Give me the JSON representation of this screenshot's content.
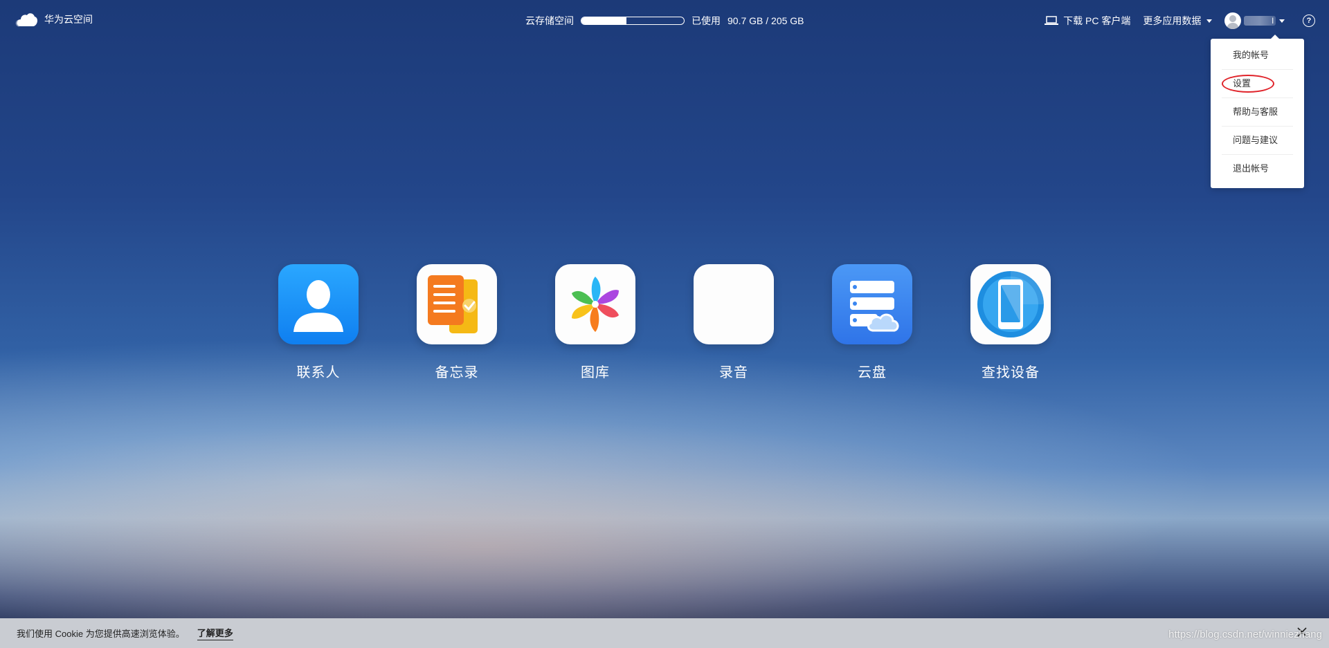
{
  "brand": {
    "name": "华为云空间",
    "logo_icon": "cloud-logo-icon"
  },
  "storage": {
    "label": "云存储空间",
    "used_label": "已使用",
    "used_text": "90.7 GB / 205 GB",
    "used_fraction": 0.442
  },
  "header": {
    "download_pc": "下载 PC 客户端",
    "more_data": "更多应用数据",
    "username": "l",
    "help_icon": "help-icon"
  },
  "user_menu": {
    "items": [
      "我的帐号",
      "设置",
      "帮助与客服",
      "问题与建议",
      "退出帐号"
    ],
    "highlighted_index": 1
  },
  "apps": [
    {
      "label": "联系人",
      "icon": "contacts-icon"
    },
    {
      "label": "备忘录",
      "icon": "notes-icon"
    },
    {
      "label": "图库",
      "icon": "gallery-icon"
    },
    {
      "label": "录音",
      "icon": "recorder-icon"
    },
    {
      "label": "云盘",
      "icon": "cloud-drive-icon"
    },
    {
      "label": "查找设备",
      "icon": "find-device-icon"
    }
  ],
  "cookie": {
    "text": "我们使用 Cookie 为您提供高速浏览体验。",
    "link": "了解更多"
  },
  "watermark": "https://blog.csdn.net/winniezhang",
  "colors": {
    "highlight_circle": "#e0232a",
    "contacts_blue": "#1a8cf5",
    "cloud_drive_blue": "#3a86f0"
  }
}
